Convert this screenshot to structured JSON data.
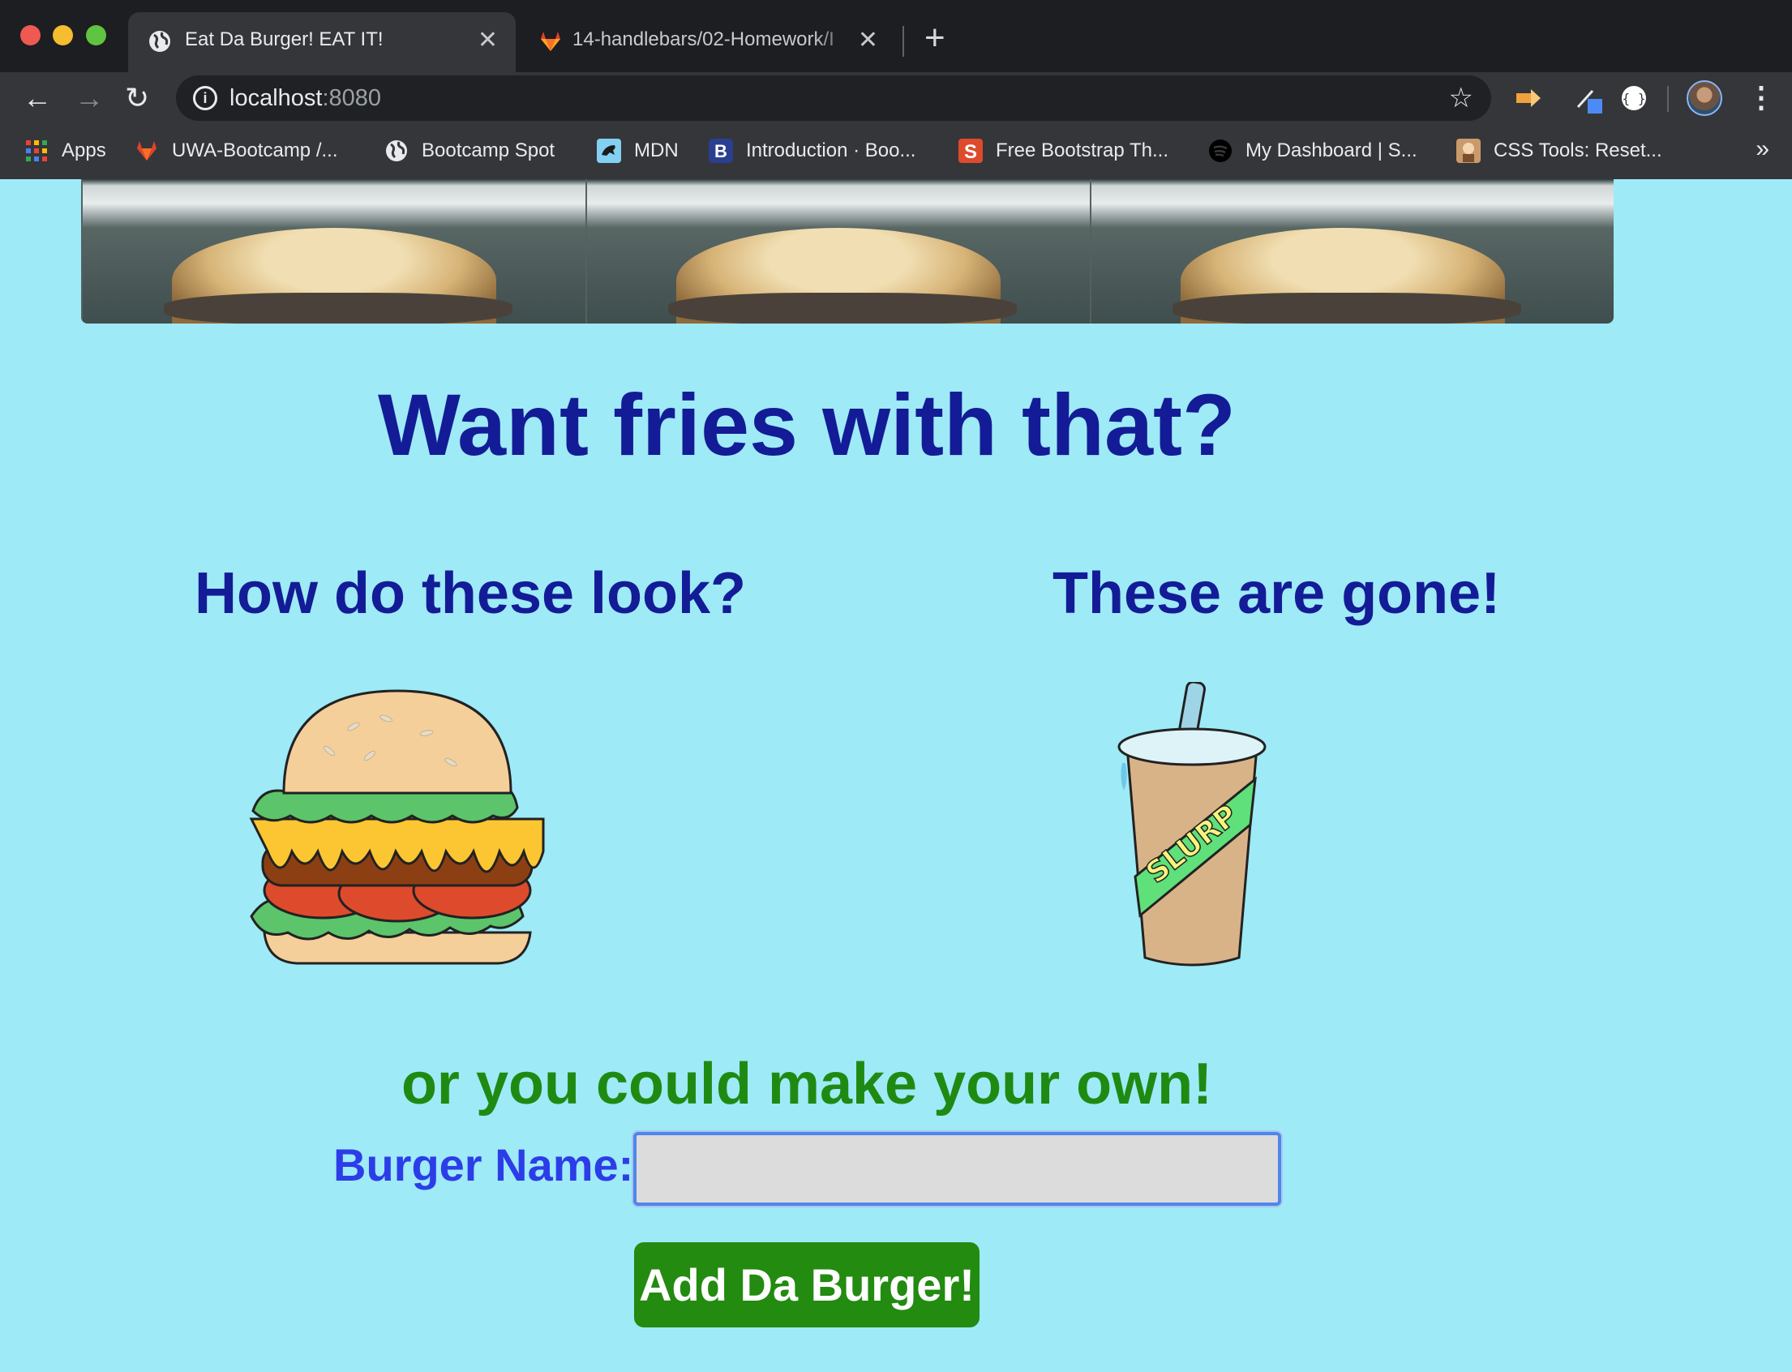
{
  "browser": {
    "tabs": [
      {
        "title": "Eat Da Burger! EAT IT!",
        "active": true,
        "icon": "globe-icon"
      },
      {
        "title": "14-handlebars/02-Homework/I",
        "active": false,
        "icon": "gitlab-icon"
      }
    ],
    "url_host": "localhost",
    "url_port": ":8080",
    "bookmarks": [
      {
        "label": "Apps",
        "icon": "apps-grid-icon"
      },
      {
        "label": "UWA-Bootcamp /...",
        "icon": "gitlab-icon"
      },
      {
        "label": "Bootcamp Spot",
        "icon": "globe-icon"
      },
      {
        "label": "MDN",
        "icon": "mdn-icon"
      },
      {
        "label": "Introduction · Boo...",
        "icon": "bootstrap-icon"
      },
      {
        "label": "Free Bootstrap Th...",
        "icon": "startbootstrap-icon"
      },
      {
        "label": "My Dashboard | S...",
        "icon": "spotify-icon"
      },
      {
        "label": "CSS Tools: Reset...",
        "icon": "css-tools-icon"
      }
    ],
    "bookmarks_more": "»"
  },
  "page": {
    "headline": "Want fries with that?",
    "left_title": "How do these look?",
    "right_title": "These are gone!",
    "subhead": "or you could make your own!",
    "form": {
      "label": "Burger Name:",
      "input_value": "",
      "button_label": "Add Da Burger!"
    }
  },
  "colors": {
    "page_bg": "#9eeaf6",
    "heading": "#131c96",
    "subhead": "#1f8a12",
    "label": "#2c3de8",
    "button_bg": "#228b10"
  }
}
